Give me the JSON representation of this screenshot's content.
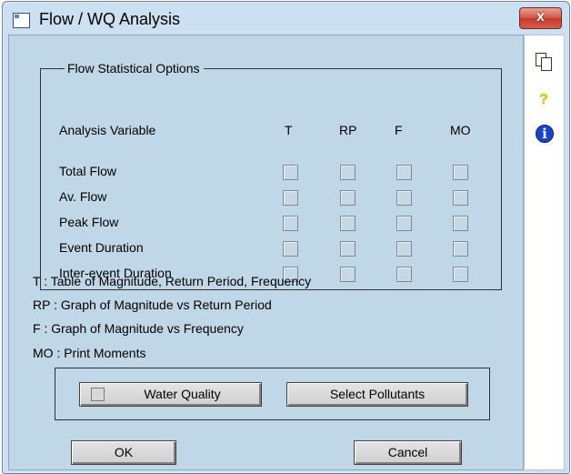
{
  "window": {
    "title": "Flow / WQ Analysis",
    "close_label": "x"
  },
  "toolstrip": {
    "icons": [
      "copy-icon",
      "help-icon",
      "info-icon"
    ],
    "help_glyph": "?",
    "info_glyph": "i"
  },
  "flow_options": {
    "title": "Flow Statistical Options",
    "analysis_variable_label": "Analysis Variable",
    "columns": [
      "T",
      "RP",
      "F",
      "MO"
    ],
    "rows": [
      {
        "label": "Total Flow",
        "checked": [
          false,
          false,
          false,
          false
        ]
      },
      {
        "label": "Av. Flow",
        "checked": [
          false,
          false,
          false,
          false
        ]
      },
      {
        "label": "Peak Flow",
        "checked": [
          false,
          false,
          false,
          false
        ]
      },
      {
        "label": "Event Duration",
        "checked": [
          false,
          false,
          false,
          false
        ]
      },
      {
        "label": "Inter-event Duration",
        "checked": [
          false,
          false,
          false,
          false
        ]
      }
    ]
  },
  "legend": [
    "T : Table of Magnitude, Return Period, Frequency",
    "RP : Graph of Magnitude vs Return Period",
    "F : Graph of Magnitude vs Frequency",
    "MO : Print Moments"
  ],
  "water_quality": {
    "water_quality_label": "Water Quality",
    "water_quality_checked": false,
    "select_pollutants_label": "Select Pollutants"
  },
  "buttons": {
    "ok": "OK",
    "cancel": "Cancel"
  },
  "colors": {
    "client_bg": "#c0d7e7",
    "frame": "#cbe0f1",
    "close": "#c43a2c"
  }
}
